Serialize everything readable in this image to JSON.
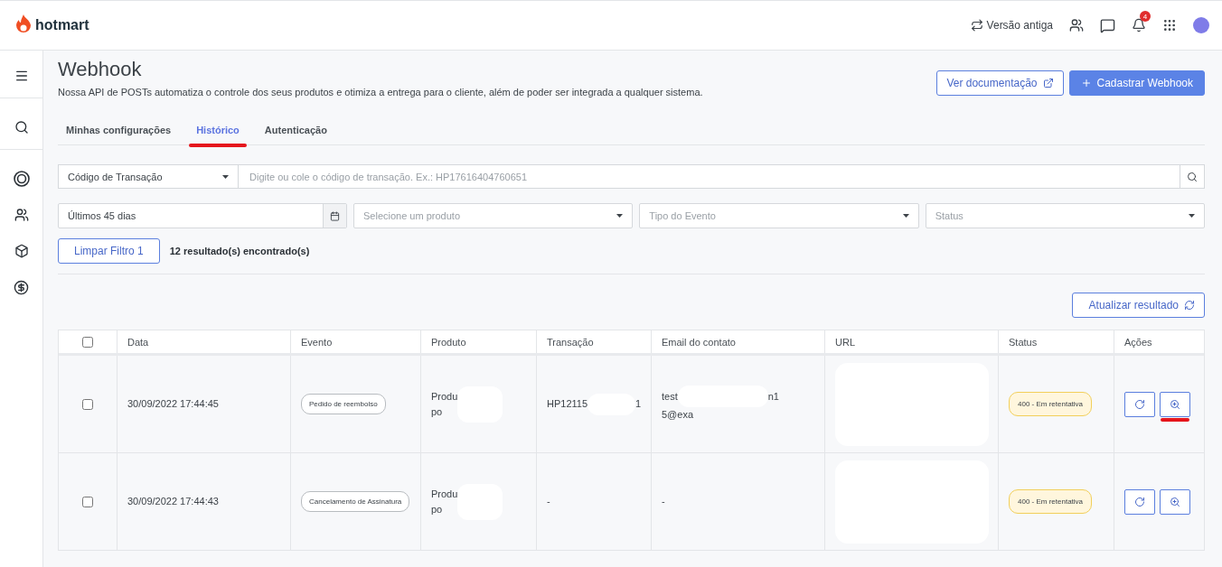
{
  "header": {
    "brand": "hotmart",
    "legacy_link": "Versão antiga",
    "notifications": "4"
  },
  "page": {
    "title": "Webhook",
    "description": "Nossa API de POSTs automatiza o controle dos seus produtos e otimiza a entrega para o cliente, além de poder ser integrada a qualquer sistema.",
    "doc_button": "Ver documentação",
    "add_button": "Cadastrar Webhook"
  },
  "tabs": [
    {
      "label": "Minhas configurações",
      "selected": false
    },
    {
      "label": "Histórico",
      "selected": true,
      "annotated": true
    },
    {
      "label": "Autenticação",
      "selected": false
    }
  ],
  "search": {
    "type_select": "Código de Transação",
    "placeholder": "Digite ou cole o código de transação. Ex.: HP17616404760651"
  },
  "filters": {
    "date": "Últimos 45 dias",
    "product_placeholder": "Selecione um produto",
    "event_placeholder": "Tipo do Evento",
    "status_placeholder": "Status"
  },
  "clear_button": "Limpar Filtro 1",
  "results": "12 resultado(s) encontrado(s)",
  "refresh_button": "Atualizar resultado",
  "table": {
    "select_all": false,
    "columns": [
      "Data",
      "Evento",
      "Produto",
      "Transação",
      "Email do contato",
      "URL",
      "Status",
      "Ações"
    ],
    "rows": [
      {
        "checked": false,
        "date": "30/09/2022 17:44:45",
        "event": "Pedido de reembolso",
        "product": [
          {
            "text": "Produ"
          },
          {
            "text": "po"
          }
        ],
        "transaction": [
          {
            "text": "HP12115",
            "tail": "1"
          }
        ],
        "email": [
          {
            "text": "test",
            "tail": "n1"
          },
          {
            "text": "5@exa"
          }
        ],
        "status": "400 - Em retentativa",
        "annotated": true
      },
      {
        "checked": false,
        "date": "30/09/2022 17:44:43",
        "event": "Cancelamento de Assinatura",
        "product": [
          {
            "text": "Produ"
          },
          {
            "text": "po"
          }
        ],
        "transaction": [
          {
            "text": "-"
          }
        ],
        "email": [
          {
            "text": "-"
          }
        ],
        "status": "400 - Em retentativa"
      }
    ]
  }
}
